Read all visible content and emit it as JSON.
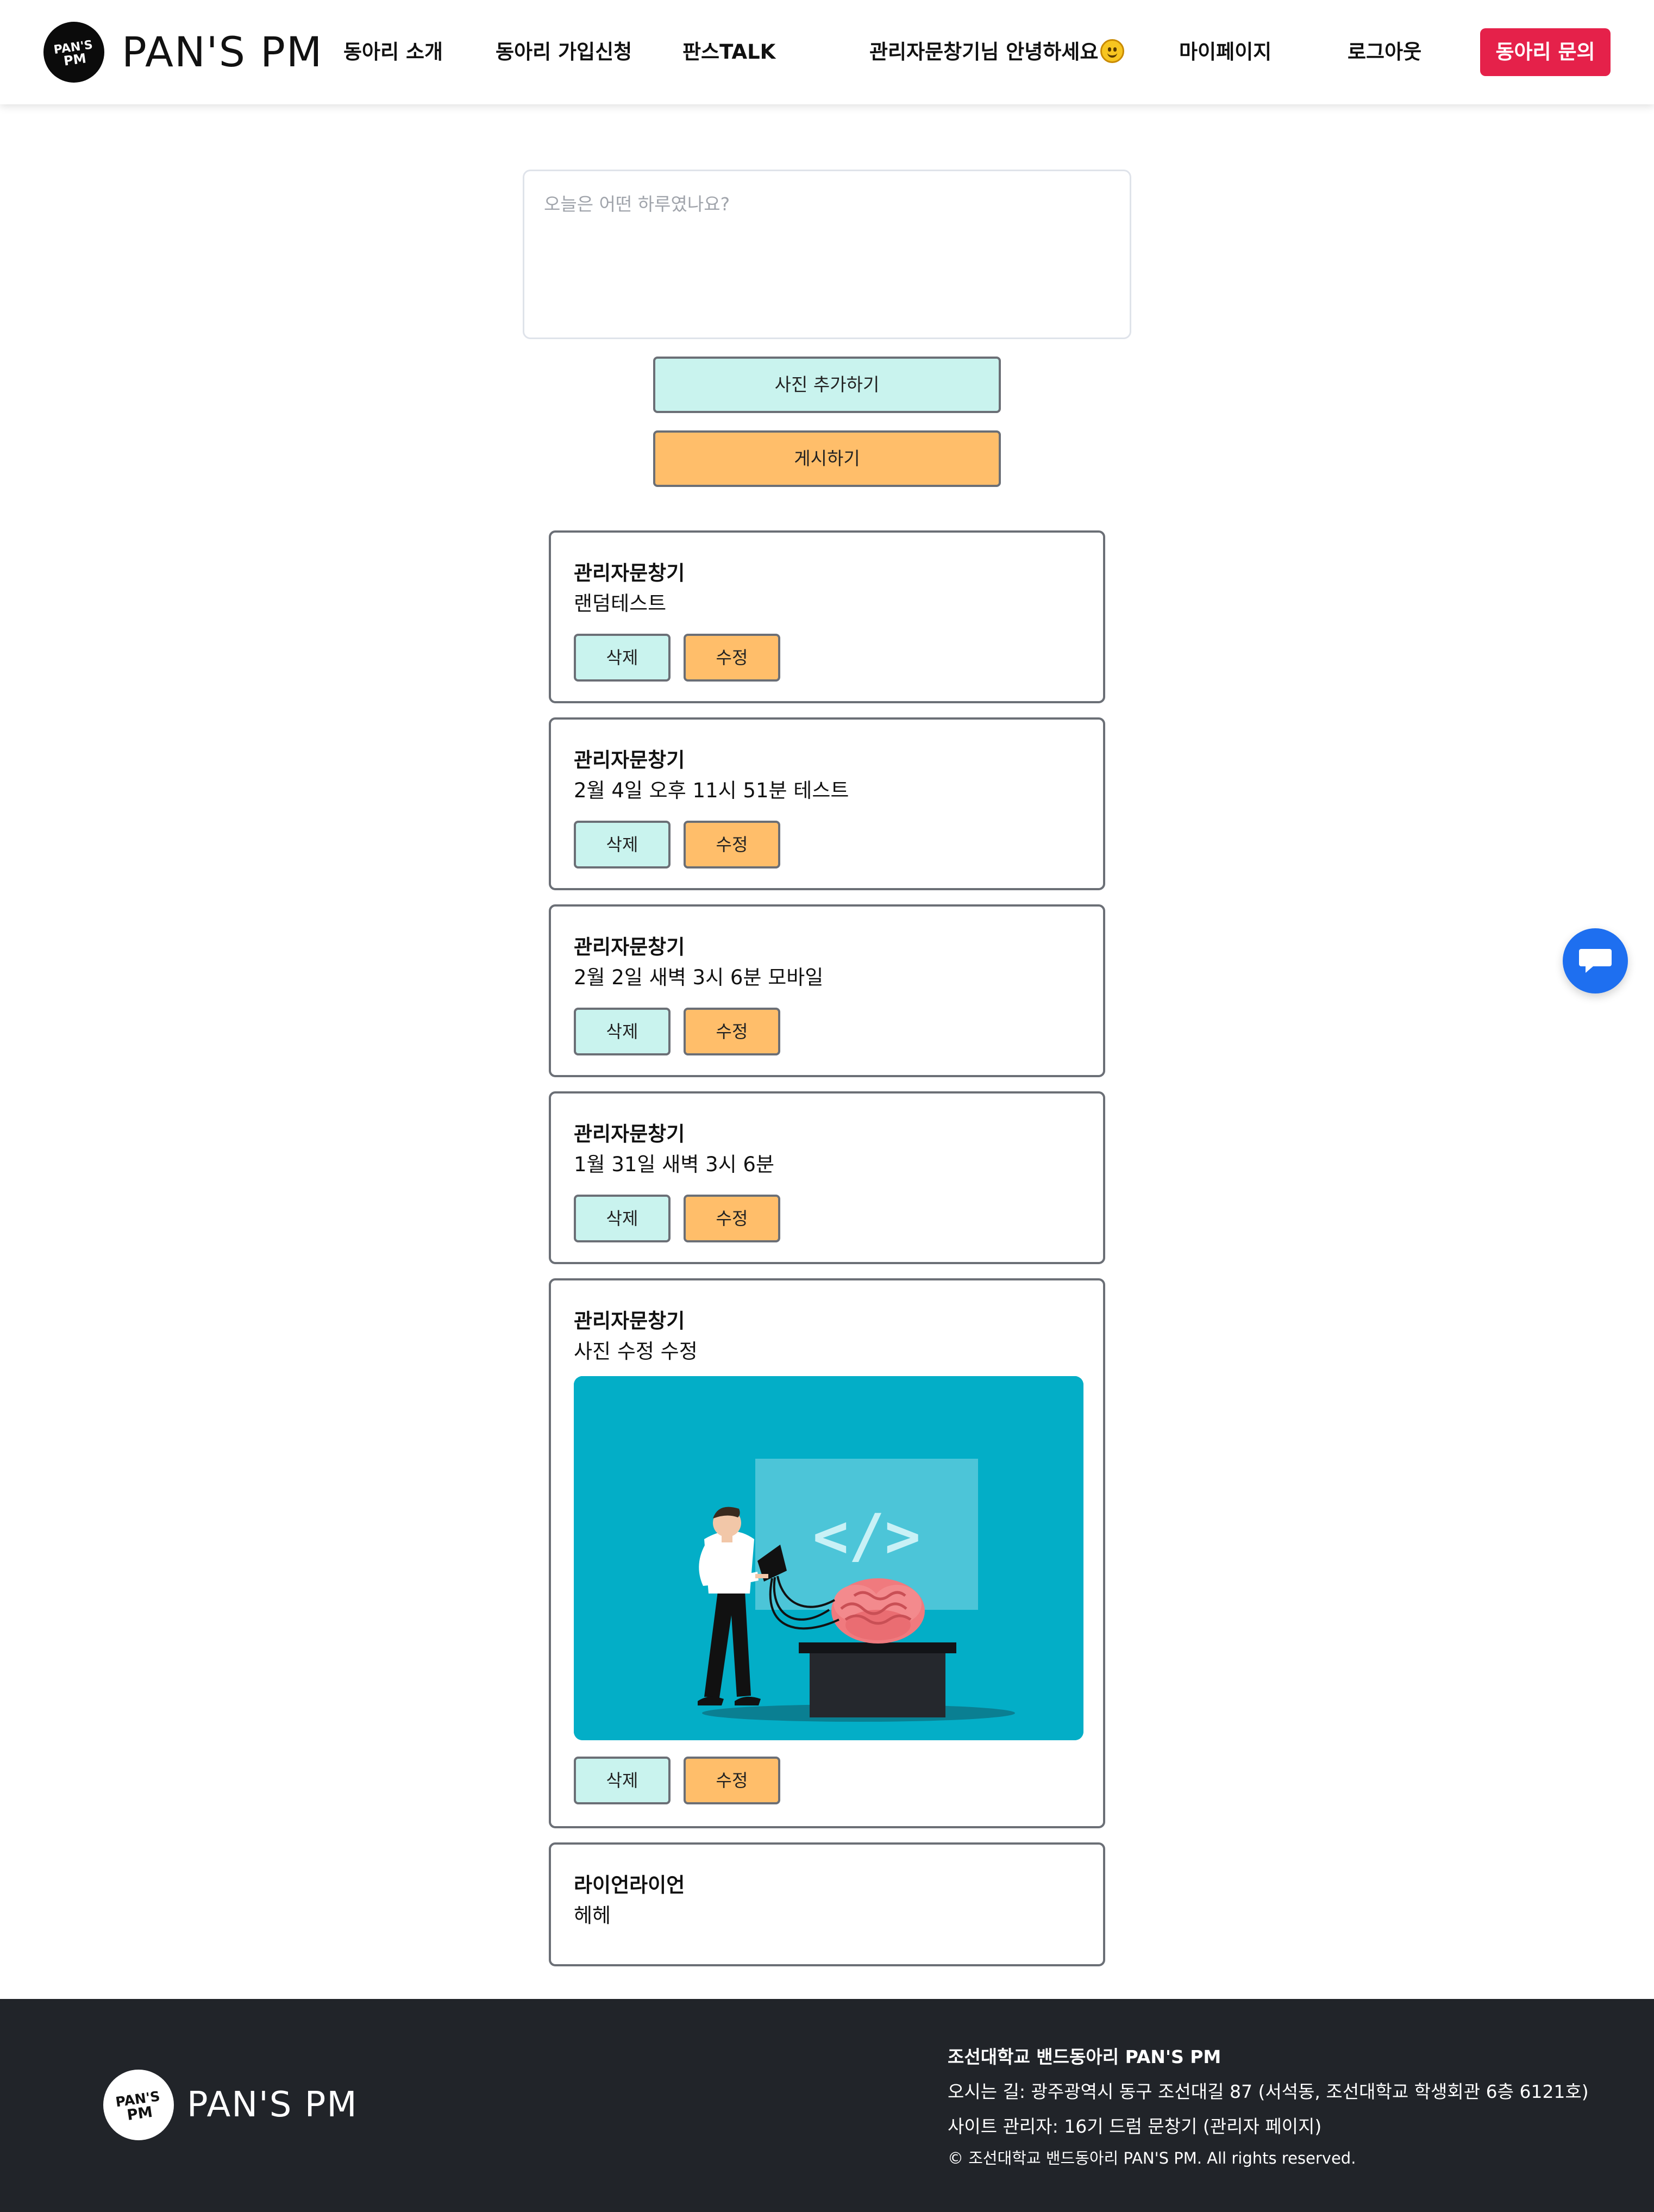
{
  "header": {
    "brand": "PAN'S PM",
    "logo_text": "PAN'S PM",
    "nav": {
      "about": "동아리 소개",
      "join": "동아리 가입신청",
      "talk": "판스TALK"
    },
    "greeting": "관리자문창기님 안녕하세요",
    "greeting_icon": "smile-emoji-icon",
    "mypage": "마이페이지",
    "logout": "로그아웃",
    "inquiry": "동아리 문의"
  },
  "compose": {
    "placeholder": "오늘은 어떤 하루였나요?",
    "add_photo": "사진 추가하기",
    "post": "게시하기"
  },
  "posts": [
    {
      "author": "관리자문창기",
      "body": "랜덤테스트",
      "delete": "삭제",
      "edit": "수정"
    },
    {
      "author": "관리자문창기",
      "body": "2월 4일 오후 11시 51분 테스트",
      "delete": "삭제",
      "edit": "수정"
    },
    {
      "author": "관리자문창기",
      "body": "2월 2일 새벽 3시 6분 모바일",
      "delete": "삭제",
      "edit": "수정"
    },
    {
      "author": "관리자문창기",
      "body": "1월 31일 새벽 3시 6분",
      "delete": "삭제",
      "edit": "수정"
    },
    {
      "author": "관리자문창기",
      "body": "사진 수정 수정",
      "image": "illustration-man-laptop-brain-code",
      "delete": "삭제",
      "edit": "수정"
    },
    {
      "author": "라이언라이언",
      "body": "헤헤"
    }
  ],
  "chat_fab_icon": "chat-bubble-icon",
  "footer": {
    "brand": "PAN'S PM",
    "org": "조선대학교 밴드동아리 PAN'S PM",
    "address": "오시는 길: 광주광역시 동구 조선대길 87 (서석동, 조선대학교 학생회관 6층 6121호)",
    "admin": "사이트 관리자: 16기 드럼 문창기 (관리자 페이지)",
    "copyright": "© 조선대학교 밴드동아리 PAN'S PM. All rights reserved."
  },
  "colors": {
    "accent_red": "#e5214a",
    "teal_button": "#c9f3ee",
    "orange_button": "#ffbe6a",
    "footer_bg": "#212429",
    "chat_blue": "#1e6ff0"
  }
}
